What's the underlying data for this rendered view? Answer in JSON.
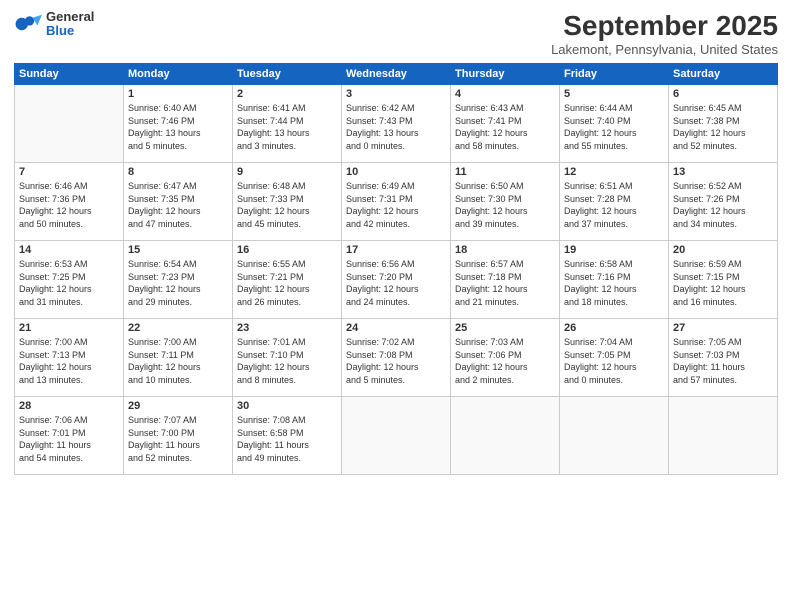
{
  "header": {
    "logo": {
      "general": "General",
      "blue": "Blue"
    },
    "title": "September 2025",
    "location": "Lakemont, Pennsylvania, United States"
  },
  "calendar": {
    "days_of_week": [
      "Sunday",
      "Monday",
      "Tuesday",
      "Wednesday",
      "Thursday",
      "Friday",
      "Saturday"
    ],
    "weeks": [
      [
        {
          "day": "",
          "info": ""
        },
        {
          "day": "1",
          "info": "Sunrise: 6:40 AM\nSunset: 7:46 PM\nDaylight: 13 hours\nand 5 minutes."
        },
        {
          "day": "2",
          "info": "Sunrise: 6:41 AM\nSunset: 7:44 PM\nDaylight: 13 hours\nand 3 minutes."
        },
        {
          "day": "3",
          "info": "Sunrise: 6:42 AM\nSunset: 7:43 PM\nDaylight: 13 hours\nand 0 minutes."
        },
        {
          "day": "4",
          "info": "Sunrise: 6:43 AM\nSunset: 7:41 PM\nDaylight: 12 hours\nand 58 minutes."
        },
        {
          "day": "5",
          "info": "Sunrise: 6:44 AM\nSunset: 7:40 PM\nDaylight: 12 hours\nand 55 minutes."
        },
        {
          "day": "6",
          "info": "Sunrise: 6:45 AM\nSunset: 7:38 PM\nDaylight: 12 hours\nand 52 minutes."
        }
      ],
      [
        {
          "day": "7",
          "info": "Sunrise: 6:46 AM\nSunset: 7:36 PM\nDaylight: 12 hours\nand 50 minutes."
        },
        {
          "day": "8",
          "info": "Sunrise: 6:47 AM\nSunset: 7:35 PM\nDaylight: 12 hours\nand 47 minutes."
        },
        {
          "day": "9",
          "info": "Sunrise: 6:48 AM\nSunset: 7:33 PM\nDaylight: 12 hours\nand 45 minutes."
        },
        {
          "day": "10",
          "info": "Sunrise: 6:49 AM\nSunset: 7:31 PM\nDaylight: 12 hours\nand 42 minutes."
        },
        {
          "day": "11",
          "info": "Sunrise: 6:50 AM\nSunset: 7:30 PM\nDaylight: 12 hours\nand 39 minutes."
        },
        {
          "day": "12",
          "info": "Sunrise: 6:51 AM\nSunset: 7:28 PM\nDaylight: 12 hours\nand 37 minutes."
        },
        {
          "day": "13",
          "info": "Sunrise: 6:52 AM\nSunset: 7:26 PM\nDaylight: 12 hours\nand 34 minutes."
        }
      ],
      [
        {
          "day": "14",
          "info": "Sunrise: 6:53 AM\nSunset: 7:25 PM\nDaylight: 12 hours\nand 31 minutes."
        },
        {
          "day": "15",
          "info": "Sunrise: 6:54 AM\nSunset: 7:23 PM\nDaylight: 12 hours\nand 29 minutes."
        },
        {
          "day": "16",
          "info": "Sunrise: 6:55 AM\nSunset: 7:21 PM\nDaylight: 12 hours\nand 26 minutes."
        },
        {
          "day": "17",
          "info": "Sunrise: 6:56 AM\nSunset: 7:20 PM\nDaylight: 12 hours\nand 24 minutes."
        },
        {
          "day": "18",
          "info": "Sunrise: 6:57 AM\nSunset: 7:18 PM\nDaylight: 12 hours\nand 21 minutes."
        },
        {
          "day": "19",
          "info": "Sunrise: 6:58 AM\nSunset: 7:16 PM\nDaylight: 12 hours\nand 18 minutes."
        },
        {
          "day": "20",
          "info": "Sunrise: 6:59 AM\nSunset: 7:15 PM\nDaylight: 12 hours\nand 16 minutes."
        }
      ],
      [
        {
          "day": "21",
          "info": "Sunrise: 7:00 AM\nSunset: 7:13 PM\nDaylight: 12 hours\nand 13 minutes."
        },
        {
          "day": "22",
          "info": "Sunrise: 7:00 AM\nSunset: 7:11 PM\nDaylight: 12 hours\nand 10 minutes."
        },
        {
          "day": "23",
          "info": "Sunrise: 7:01 AM\nSunset: 7:10 PM\nDaylight: 12 hours\nand 8 minutes."
        },
        {
          "day": "24",
          "info": "Sunrise: 7:02 AM\nSunset: 7:08 PM\nDaylight: 12 hours\nand 5 minutes."
        },
        {
          "day": "25",
          "info": "Sunrise: 7:03 AM\nSunset: 7:06 PM\nDaylight: 12 hours\nand 2 minutes."
        },
        {
          "day": "26",
          "info": "Sunrise: 7:04 AM\nSunset: 7:05 PM\nDaylight: 12 hours\nand 0 minutes."
        },
        {
          "day": "27",
          "info": "Sunrise: 7:05 AM\nSunset: 7:03 PM\nDaylight: 11 hours\nand 57 minutes."
        }
      ],
      [
        {
          "day": "28",
          "info": "Sunrise: 7:06 AM\nSunset: 7:01 PM\nDaylight: 11 hours\nand 54 minutes."
        },
        {
          "day": "29",
          "info": "Sunrise: 7:07 AM\nSunset: 7:00 PM\nDaylight: 11 hours\nand 52 minutes."
        },
        {
          "day": "30",
          "info": "Sunrise: 7:08 AM\nSunset: 6:58 PM\nDaylight: 11 hours\nand 49 minutes."
        },
        {
          "day": "",
          "info": ""
        },
        {
          "day": "",
          "info": ""
        },
        {
          "day": "",
          "info": ""
        },
        {
          "day": "",
          "info": ""
        }
      ]
    ]
  }
}
